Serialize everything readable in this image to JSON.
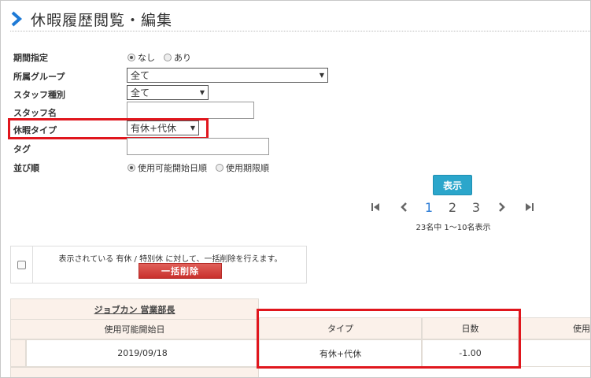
{
  "header": {
    "title": "休暇履歴閲覧・編集"
  },
  "form": {
    "period": {
      "label": "期間指定",
      "options": [
        "なし",
        "あり"
      ],
      "selected": "なし"
    },
    "group": {
      "label": "所属グループ",
      "value": "全て"
    },
    "staff_type": {
      "label": "スタッフ種別",
      "value": "全て"
    },
    "staff_name": {
      "label": "スタッフ名",
      "value": ""
    },
    "leave_type": {
      "label": "休暇タイプ",
      "value": "有休+代休"
    },
    "tag": {
      "label": "タグ",
      "value": ""
    },
    "order": {
      "label": "並び順",
      "options": [
        "使用可能開始日順",
        "使用期限順"
      ],
      "selected": "使用可能開始日順"
    }
  },
  "actions": {
    "show_label": "表示"
  },
  "pagination": {
    "first": "⏮",
    "prev": "‹",
    "next": "›",
    "last": "⏭",
    "pages": [
      "1",
      "2",
      "3"
    ],
    "current": "1",
    "info": "23名中 1〜10名表示"
  },
  "bulk": {
    "message": "表示されている 有休 / 特別休 に対して、一括削除を行えます。",
    "delete_label": "一括削除"
  },
  "table": {
    "staff_name": "ジョブカン 営業部長",
    "headers": {
      "start_date": "使用可能開始日",
      "type": "タイプ",
      "days": "日数",
      "use": "使用"
    },
    "rows": [
      {
        "start_date": "2019/09/18",
        "type": "有休+代休",
        "days": "-1.00",
        "use": "-"
      }
    ]
  },
  "colors": {
    "accent": "#2a7ad5",
    "show_button": "#2ba6cb",
    "delete_button": "#d9534f",
    "highlight": "#e0161d",
    "header_bg": "#fbf1ea"
  }
}
